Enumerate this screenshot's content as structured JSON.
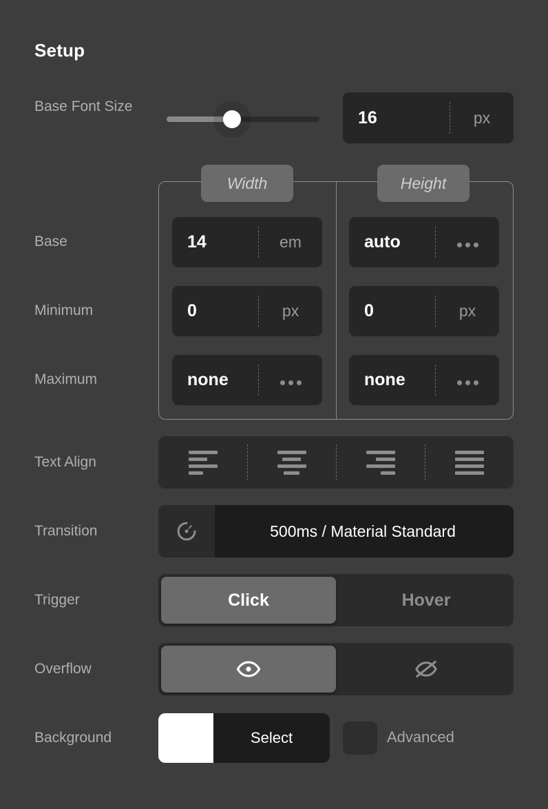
{
  "panel": {
    "title": "Setup",
    "background_color": "#3d3d3d"
  },
  "rows": {
    "base_font_size": {
      "label": "Base Font Size",
      "slider": {
        "name": "base-font-size-slider",
        "value": 16,
        "percent": 43
      },
      "field": {
        "value": "16",
        "unit": "px"
      }
    },
    "size_group": {
      "tabs": [
        {
          "label": "Width"
        },
        {
          "label": "Height"
        }
      ],
      "base": {
        "label": "Base",
        "width": {
          "value": "14",
          "unit": "em"
        },
        "height": {
          "value": "auto",
          "unit": "more-dots"
        }
      },
      "minimum": {
        "label": "Minimum",
        "width": {
          "value": "0",
          "unit": "px"
        },
        "height": {
          "value": "0",
          "unit": "px"
        }
      },
      "maximum": {
        "label": "Maximum",
        "width": {
          "value": "none",
          "unit": "more-dots"
        },
        "height": {
          "value": "none",
          "unit": "more-dots"
        }
      }
    },
    "text_align": {
      "label": "Text Align",
      "options": [
        {
          "icon": "align-left-icon",
          "selected": false
        },
        {
          "icon": "align-center-icon",
          "selected": false
        },
        {
          "icon": "align-right-icon",
          "selected": false
        },
        {
          "icon": "align-justify-icon",
          "selected": false
        }
      ]
    },
    "transition": {
      "label": "Transition",
      "icon": "stopwatch-icon",
      "value": "500ms / Material Standard"
    },
    "trigger": {
      "label": "Trigger",
      "options": [
        {
          "label": "Click",
          "selected": true
        },
        {
          "label": "Hover",
          "selected": false
        }
      ]
    },
    "overflow": {
      "label": "Overflow",
      "options": [
        {
          "icon": "eye-icon",
          "selected": true
        },
        {
          "icon": "eye-off-icon",
          "selected": false
        }
      ]
    },
    "background": {
      "label": "Background",
      "swatch_color": "#ffffff",
      "select_label": "Select",
      "advanced_label": "Advanced",
      "advanced_checked": false
    }
  }
}
